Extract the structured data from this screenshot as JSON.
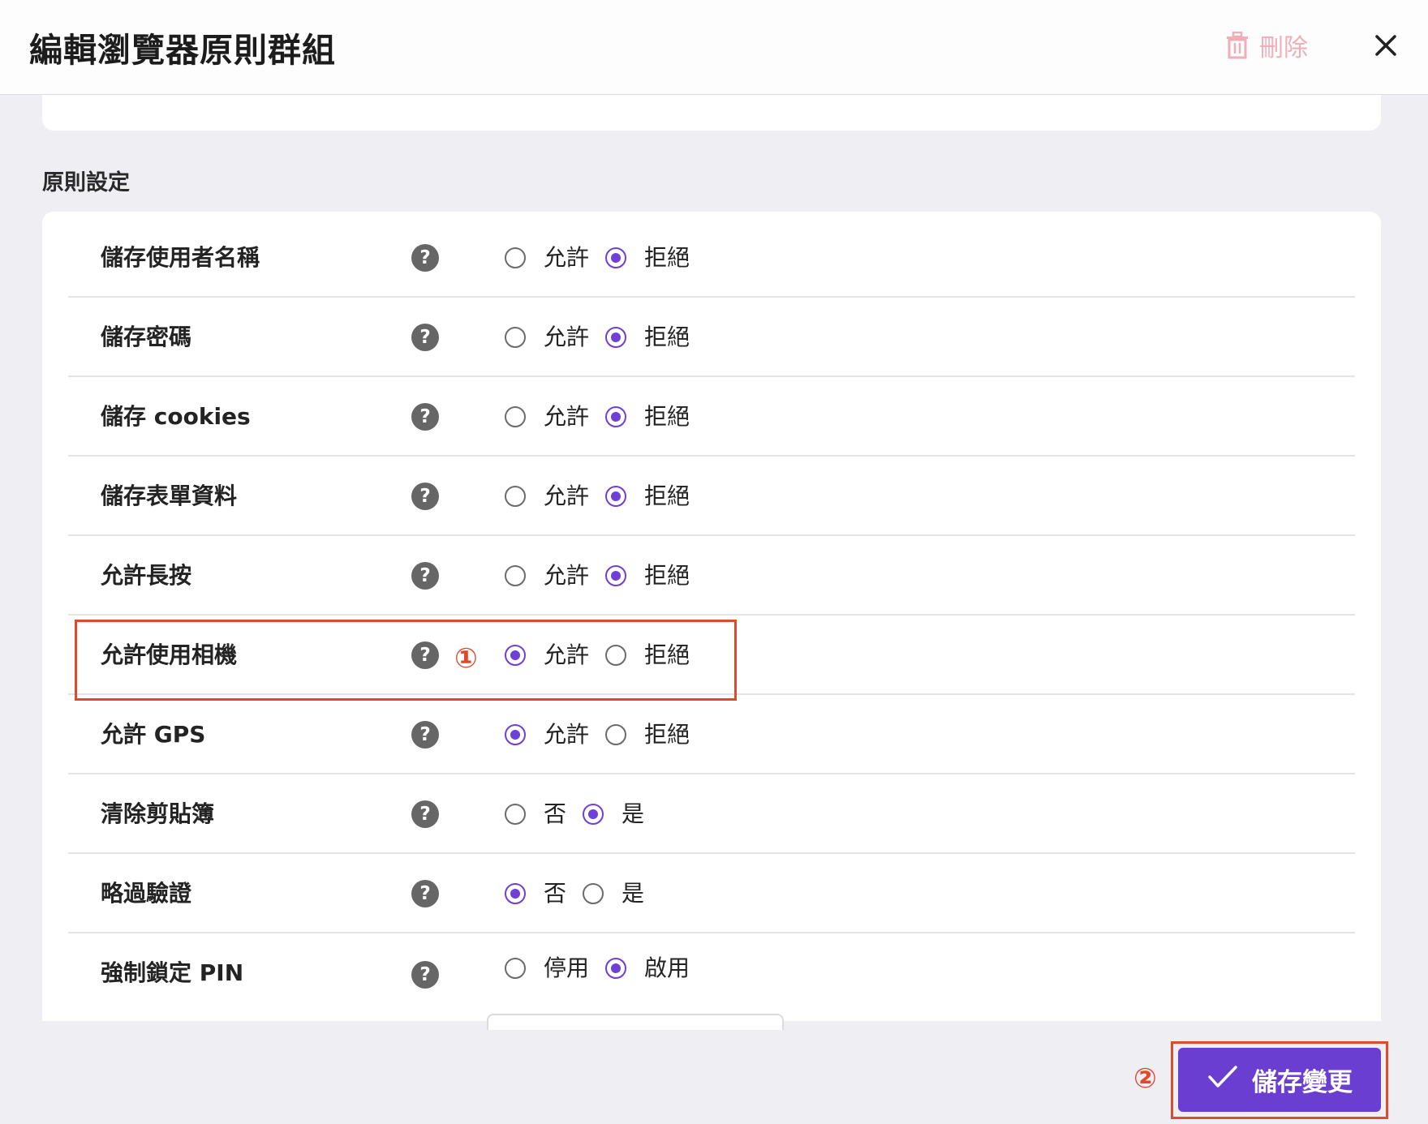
{
  "header": {
    "title": "編輯瀏覽器原則群組",
    "delete_label": "刪除"
  },
  "section": {
    "title": "原則設定"
  },
  "help_glyph": "?",
  "colors": {
    "accent": "#6a3ed0",
    "radio_checked": "#6f3fd6",
    "delete_disabled": "#f1aeb9",
    "annotation": "#dd4b2c"
  },
  "settings": [
    {
      "label": "儲存使用者名稱",
      "options": [
        "允許",
        "拒絕"
      ],
      "selected": 1
    },
    {
      "label": "儲存密碼",
      "options": [
        "允許",
        "拒絕"
      ],
      "selected": 1
    },
    {
      "label": "儲存 cookies",
      "options": [
        "允許",
        "拒絕"
      ],
      "selected": 1
    },
    {
      "label": "儲存表單資料",
      "options": [
        "允許",
        "拒絕"
      ],
      "selected": 1
    },
    {
      "label": "允許長按",
      "options": [
        "允許",
        "拒絕"
      ],
      "selected": 1
    },
    {
      "label": "允許使用相機",
      "options": [
        "允許",
        "拒絕"
      ],
      "selected": 0
    },
    {
      "label": "允許 GPS",
      "options": [
        "允許",
        "拒絕"
      ],
      "selected": 0
    },
    {
      "label": "清除剪貼簿",
      "options": [
        "否",
        "是"
      ],
      "selected": 1
    },
    {
      "label": "略過驗證",
      "options": [
        "否",
        "是"
      ],
      "selected": 0
    },
    {
      "label": "強制鎖定 PIN",
      "options": [
        "停用",
        "啟用"
      ],
      "selected": 1
    }
  ],
  "annotations": {
    "step1": "①",
    "step2": "②"
  },
  "footer": {
    "save_label": "儲存變更"
  }
}
